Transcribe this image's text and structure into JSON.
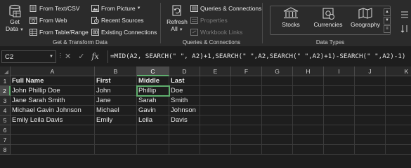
{
  "ribbon": {
    "get_data": {
      "label1": "Get",
      "label2": "Data"
    },
    "from_text_csv": "From Text/CSV",
    "from_web": "From Web",
    "from_table_range": "From Table/Range",
    "from_picture": "From Picture",
    "recent_sources": "Recent Sources",
    "existing_connections": "Existing Connections",
    "group_get_transform": "Get & Transform Data",
    "refresh_all": {
      "label1": "Refresh",
      "label2": "All"
    },
    "queries_connections": "Queries & Connections",
    "properties": "Properties",
    "workbook_links": "Workbook Links",
    "group_queries": "Queries & Connections",
    "data_types": [
      "Stocks",
      "Currencies",
      "Geography"
    ],
    "group_data_types": "Data Types"
  },
  "formula_bar": {
    "name_box": "C2",
    "dots": "⋮",
    "formula": "=MID(A2, SEARCH(\" \", A2)+1,SEARCH(\" \",A2,SEARCH(\" \",A2)+1)-SEARCH(\" \",A2)-1)"
  },
  "grid": {
    "columns": [
      "A",
      "B",
      "C",
      "D",
      "E",
      "F",
      "G",
      "H",
      "I",
      "J",
      "K"
    ],
    "rows": [
      "1",
      "2",
      "3",
      "4",
      "5",
      "6",
      "7",
      "8"
    ],
    "selected_column": "C",
    "selected_row": "2",
    "active_cell": "C2",
    "headers": [
      "Full Name",
      "First",
      "Middle",
      "Last"
    ],
    "data": [
      [
        "John Phillip Doe",
        "John",
        "Phillip",
        "Doe"
      ],
      [
        "Jane Sarah Smith",
        "Jane",
        "Sarah",
        "Smith"
      ],
      [
        "Michael Gavin Johnson",
        "Michael",
        "Gavin",
        "Johnson"
      ],
      [
        "Emily Leila Davis",
        "Emily",
        "Leila",
        "Davis"
      ]
    ]
  },
  "colors": {
    "background": "#1e1e1e",
    "ribbon": "#2b2b2b",
    "selection_accent": "#5fae6e"
  }
}
